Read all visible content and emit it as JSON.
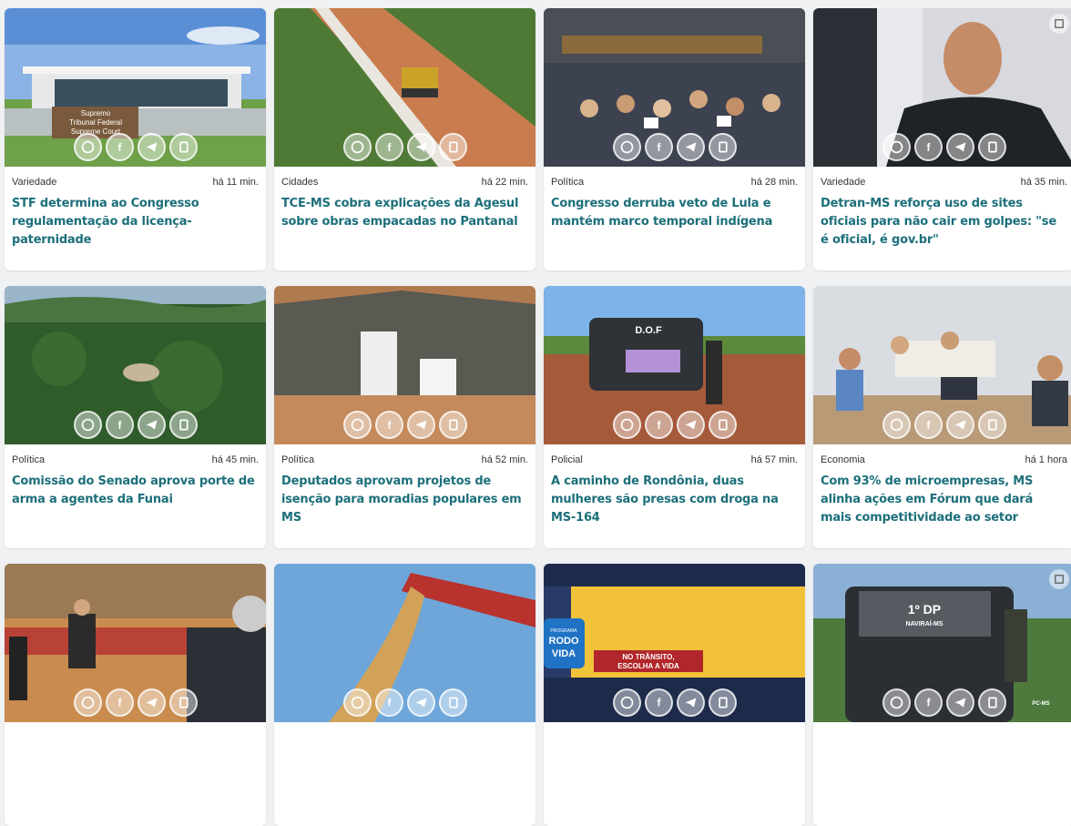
{
  "cards": [
    {
      "category": "Variedade",
      "time": "há 11 min.",
      "title": "STF determina ao Congresso regulamentação da licença-paternidade",
      "image_text": [
        "Supremo",
        "Tribunal Federal",
        "Supreme Court"
      ]
    },
    {
      "category": "Cidades",
      "time": "há 22 min.",
      "title": "TCE-MS cobra explicações da Agesul sobre obras empacadas no Pantanal"
    },
    {
      "category": "Política",
      "time": "há 28 min.",
      "title": "Congresso derruba veto de Lula e mantém marco temporal indígena"
    },
    {
      "category": "Variedade",
      "time": "há 35 min.",
      "title": "Detran-MS reforça uso de sites oficiais para não cair em golpes: \"se é oficial, é gov.br\""
    },
    {
      "category": "Política",
      "time": "há 45 min.",
      "title": "Comissão do Senado aprova porte de arma a agentes da Funai"
    },
    {
      "category": "Política",
      "time": "há 52 min.",
      "title": "Deputados aprovam projetos de isenção para moradias populares em MS"
    },
    {
      "category": "Policial",
      "time": "há 57 min.",
      "title": "A caminho de Rondônia, duas mulheres são presas com droga na MS-164",
      "image_text": [
        "D.O.F"
      ]
    },
    {
      "category": "Economia",
      "time": "há 1 hora",
      "title": "Com 93% de microempresas, MS alinha ações em Fórum que dará mais competitividade ao setor"
    },
    {
      "category": "",
      "time": "",
      "title": ""
    },
    {
      "category": "",
      "time": "",
      "title": ""
    },
    {
      "category": "",
      "time": "",
      "title": "",
      "image_text": [
        "PROGRAMA",
        "RODO",
        "VIDA",
        "NO TRÂNSITO,",
        "ESCOLHA A VIDA"
      ]
    },
    {
      "category": "",
      "time": "",
      "title": "",
      "image_text": [
        "1º DP",
        "NAVIRAÍ-MS",
        "PC-MS"
      ]
    }
  ],
  "share_icons": [
    "whatsapp-icon",
    "facebook-icon",
    "telegram-icon",
    "copy-link-icon"
  ],
  "colors": {
    "title": "#1c6f7a",
    "background": "#f0f1f3",
    "card": "#ffffff"
  }
}
